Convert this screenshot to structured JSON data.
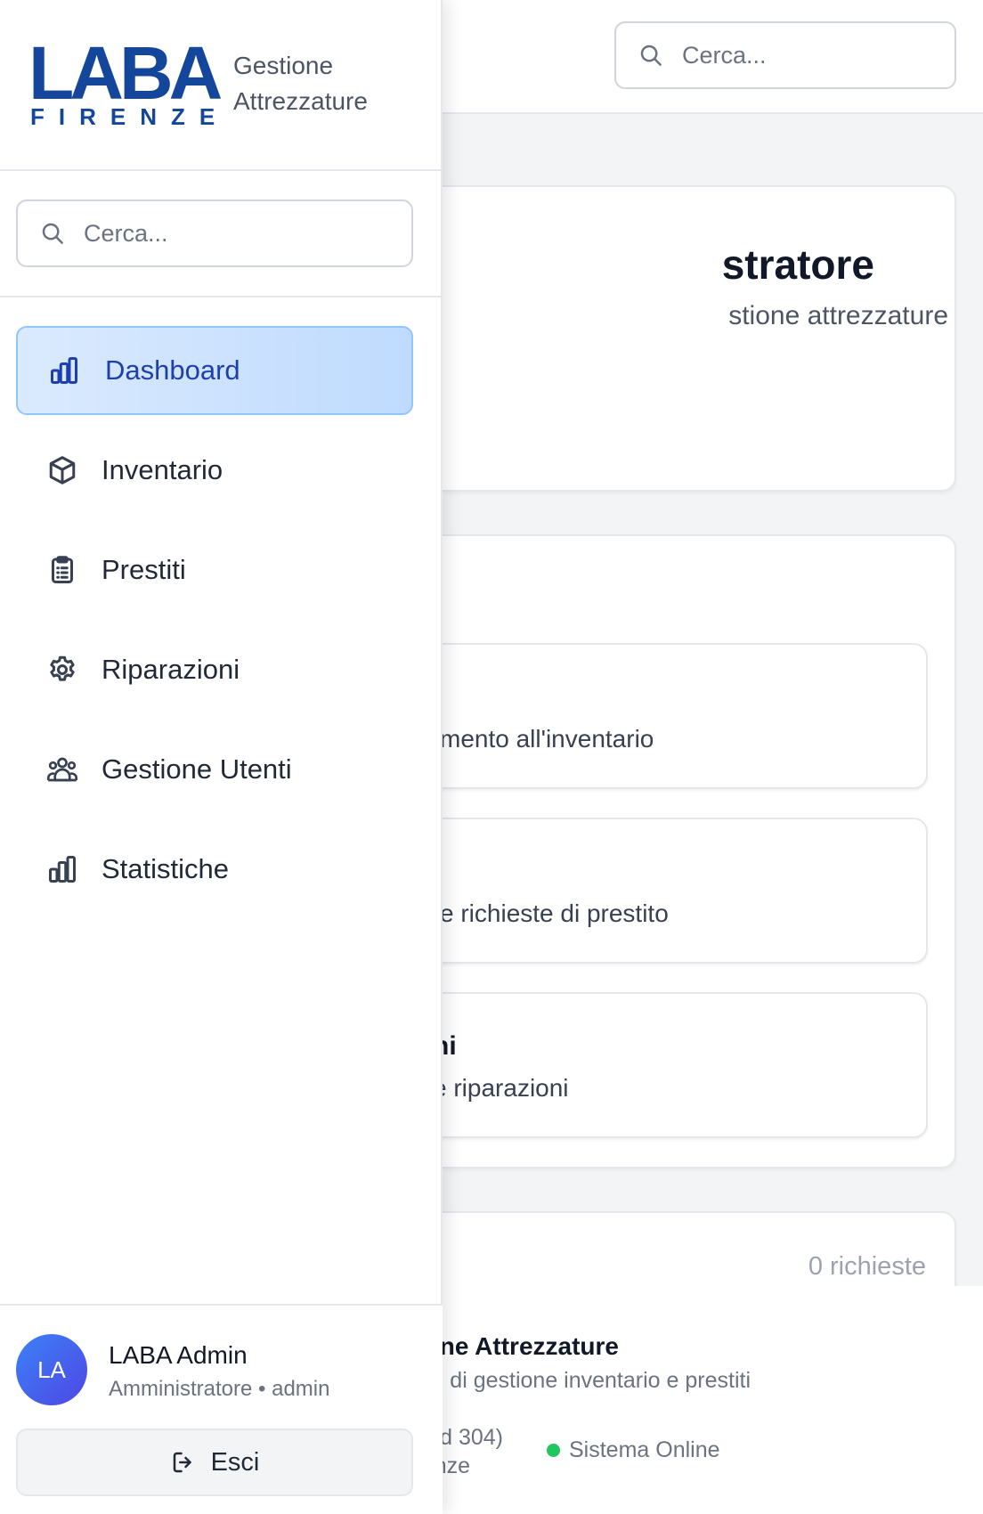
{
  "header": {
    "search_placeholder": "Cerca..."
  },
  "welcome": {
    "title_fragment": "stratore",
    "subtitle_fragment": "stione attrezzature"
  },
  "actions": [
    {
      "title_fragment": "",
      "desc_fragment": "mento all'inventario"
    },
    {
      "title_fragment": "",
      "desc_fragment": "e richieste di prestito"
    },
    {
      "title_fragment": "ni",
      "desc_fragment": "e riparazioni"
    }
  ],
  "requests": {
    "count_label": "0 richieste"
  },
  "footer": {
    "title_fragment": "ne Attrezzature",
    "desc_fragment": "di gestione inventario e prestiti",
    "address_line1_fragment": "d 304)",
    "address_line2_fragment": "nze",
    "status_label": "Sistema Online",
    "status_color": "#22c55e"
  },
  "sidebar": {
    "logo_main": "LABA",
    "logo_sub": "FIRENZE",
    "app_subtitle_line1": "Gestione",
    "app_subtitle_line2": "Attrezzature",
    "search_placeholder": "Cerca...",
    "items": [
      {
        "label": "Dashboard",
        "icon": "bar-chart-icon",
        "active": true
      },
      {
        "label": "Inventario",
        "icon": "cube-icon",
        "active": false
      },
      {
        "label": "Prestiti",
        "icon": "clipboard-list-icon",
        "active": false
      },
      {
        "label": "Riparazioni",
        "icon": "gear-icon",
        "active": false
      },
      {
        "label": "Gestione Utenti",
        "icon": "users-icon",
        "active": false
      },
      {
        "label": "Statistiche",
        "icon": "bar-chart-icon",
        "active": false
      }
    ],
    "user": {
      "initials": "LA",
      "name": "LABA Admin",
      "role": "Amministratore • admin"
    },
    "logout_label": "Esci"
  },
  "colors": {
    "brand": "#14479b",
    "active_nav_text": "#1e40af",
    "active_nav_border": "#93c5fd"
  }
}
